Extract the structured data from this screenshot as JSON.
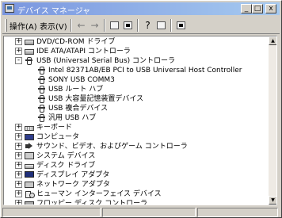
{
  "window": {
    "title": "デバイス マネージャ",
    "minimize_glyph": "_",
    "maximize_glyph": "□",
    "close_glyph": "x"
  },
  "menu": {
    "action": "操作(A)",
    "view": "表示(V)"
  },
  "toolbar": {
    "back_glyph": "←",
    "forward_glyph": "→",
    "properties_glyph": "?"
  },
  "tree": {
    "items": [
      {
        "label": "DVD/CD-ROM ドライブ",
        "expander": "+",
        "icon": "dvd-drive-icon"
      },
      {
        "label": "IDE ATA/ATAPI コントローラ",
        "expander": "+",
        "icon": "ide-controller-icon"
      },
      {
        "label": "USB (Universal Serial Bus) コントローラ",
        "expander": "-",
        "icon": "usb-controller-icon"
      },
      {
        "label": "Intel 82371AB/EB PCI to USB Universal Host Controller",
        "icon": "usb-device-icon"
      },
      {
        "label": "SONY USB COMM3",
        "icon": "usb-device-icon"
      },
      {
        "label": "USB ルート ハブ",
        "icon": "usb-device-icon"
      },
      {
        "label": "USB 大容量記憶装置デバイス",
        "icon": "usb-device-icon"
      },
      {
        "label": "USB 複合デバイス",
        "icon": "usb-device-icon"
      },
      {
        "label": "汎用 USB ハブ",
        "icon": "usb-device-icon"
      },
      {
        "label": "キーボード",
        "expander": "+",
        "icon": "keyboard-icon"
      },
      {
        "label": "コンピュータ",
        "expander": "+",
        "icon": "computer-icon"
      },
      {
        "label": "サウンド、ビデオ、およびゲーム コントローラ",
        "expander": "+",
        "icon": "sound-icon"
      },
      {
        "label": "システム デバイス",
        "expander": "+",
        "icon": "system-device-icon"
      },
      {
        "label": "ディスク ドライブ",
        "expander": "+",
        "icon": "disk-drive-icon"
      },
      {
        "label": "ディスプレイ アダプタ",
        "expander": "+",
        "icon": "display-adapter-icon"
      },
      {
        "label": "ネットワーク アダプタ",
        "expander": "+",
        "icon": "network-adapter-icon"
      },
      {
        "label": "ヒューマン インターフェイス デバイス",
        "expander": "+",
        "icon": "hid-icon"
      },
      {
        "label": "フロッピー ディスク コントローラ",
        "expander": "+",
        "icon": "floppy-controller-icon"
      }
    ]
  },
  "scrollbar": {
    "up_glyph": "▲",
    "down_glyph": "▼"
  }
}
